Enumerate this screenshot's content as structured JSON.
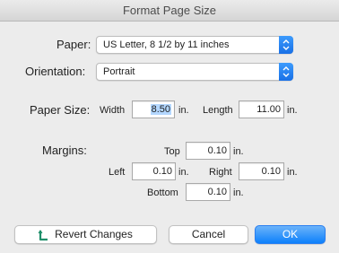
{
  "window": {
    "title": "Format Page Size"
  },
  "paper": {
    "label": "Paper:",
    "selected": "US Letter, 8 1/2 by 11 inches"
  },
  "orientation": {
    "label": "Orientation:",
    "selected": "Portrait"
  },
  "paper_size": {
    "label": "Paper Size:",
    "width_label": "Width",
    "width_value": "8.50",
    "width_unit": "in.",
    "length_label": "Length",
    "length_value": "11.00",
    "length_unit": "in."
  },
  "margins": {
    "label": "Margins:",
    "top_label": "Top",
    "top_value": "0.10",
    "top_unit": "in.",
    "left_label": "Left",
    "left_value": "0.10",
    "left_unit": "in.",
    "right_label": "Right",
    "right_value": "0.10",
    "right_unit": "in.",
    "bottom_label": "Bottom",
    "bottom_value": "0.10",
    "bottom_unit": "in."
  },
  "buttons": {
    "revert_label": "Revert Changes",
    "revert_icon": "revert-arrow-icon",
    "cancel_label": "Cancel",
    "ok_label": "OK"
  },
  "colors": {
    "accent": "#1a76f0",
    "selection": "#b3d7ff"
  }
}
